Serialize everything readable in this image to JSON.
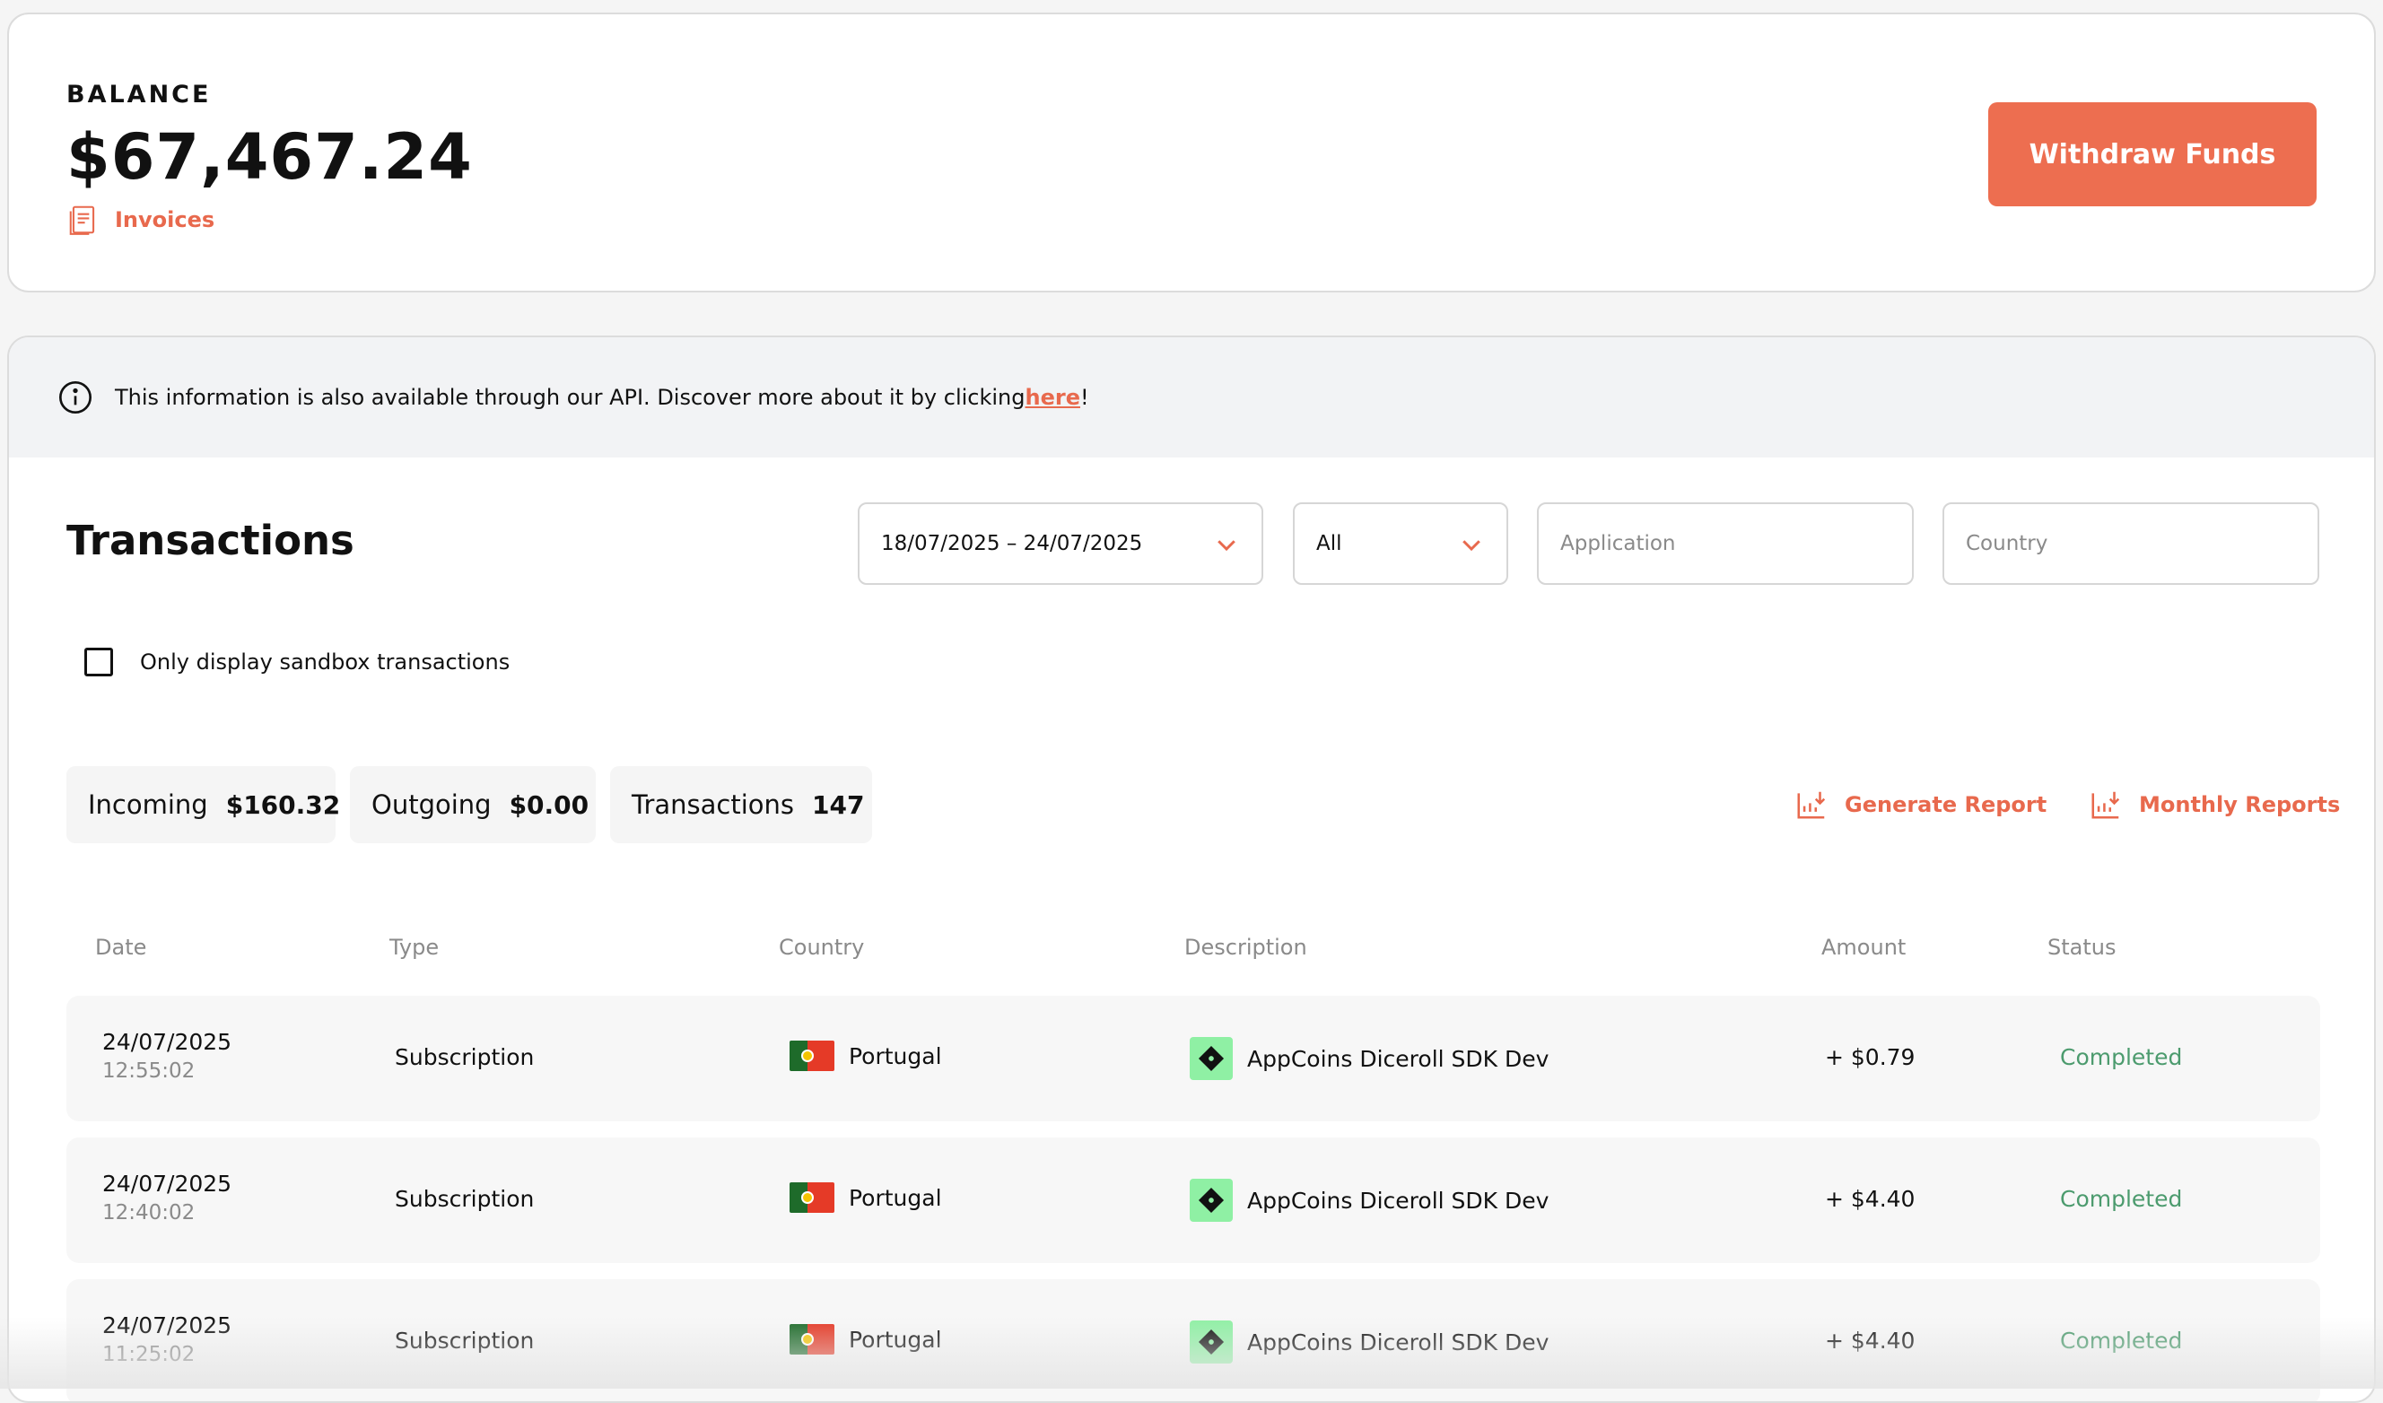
{
  "balance": {
    "label": "BALANCE",
    "amount": "$67,467.24",
    "invoices_label": "Invoices",
    "withdraw_label": "Withdraw Funds"
  },
  "info": {
    "text": "This information is also available through our API. Discover more about it by clicking ",
    "link": "here",
    "suffix": "!"
  },
  "transactions": {
    "title": "Transactions",
    "filters": {
      "date_range": "18/07/2025 – 24/07/2025",
      "type": "All",
      "application_placeholder": "Application",
      "country_placeholder": "Country"
    },
    "sandbox_label": "Only display sandbox transactions",
    "stats": {
      "incoming_label": "Incoming",
      "incoming_value": "$160.32",
      "outgoing_label": "Outgoing",
      "outgoing_value": "$0.00",
      "count_label": "Transactions",
      "count_value": "147"
    },
    "generate_report": "Generate Report",
    "monthly_reports": "Monthly Reports",
    "columns": [
      "Date",
      "Type",
      "Country",
      "Description",
      "Amount",
      "Status"
    ],
    "rows": [
      {
        "date": "24/07/2025",
        "time": "12:55:02",
        "type": "Subscription",
        "country": "Portugal",
        "description": "AppCoins Diceroll SDK Dev",
        "amount": "+ $0.79",
        "status": "Completed"
      },
      {
        "date": "24/07/2025",
        "time": "12:40:02",
        "type": "Subscription",
        "country": "Portugal",
        "description": "AppCoins Diceroll SDK Dev",
        "amount": "+ $4.40",
        "status": "Completed"
      },
      {
        "date": "24/07/2025",
        "time": "11:25:02",
        "type": "Subscription",
        "country": "Portugal",
        "description": "AppCoins Diceroll SDK Dev",
        "amount": "+ $4.40",
        "status": "Completed"
      }
    ]
  },
  "colors": {
    "accent": "#ed6e50",
    "status_completed": "#4c9b6e",
    "app_icon_bg": "#8ff0a4"
  }
}
